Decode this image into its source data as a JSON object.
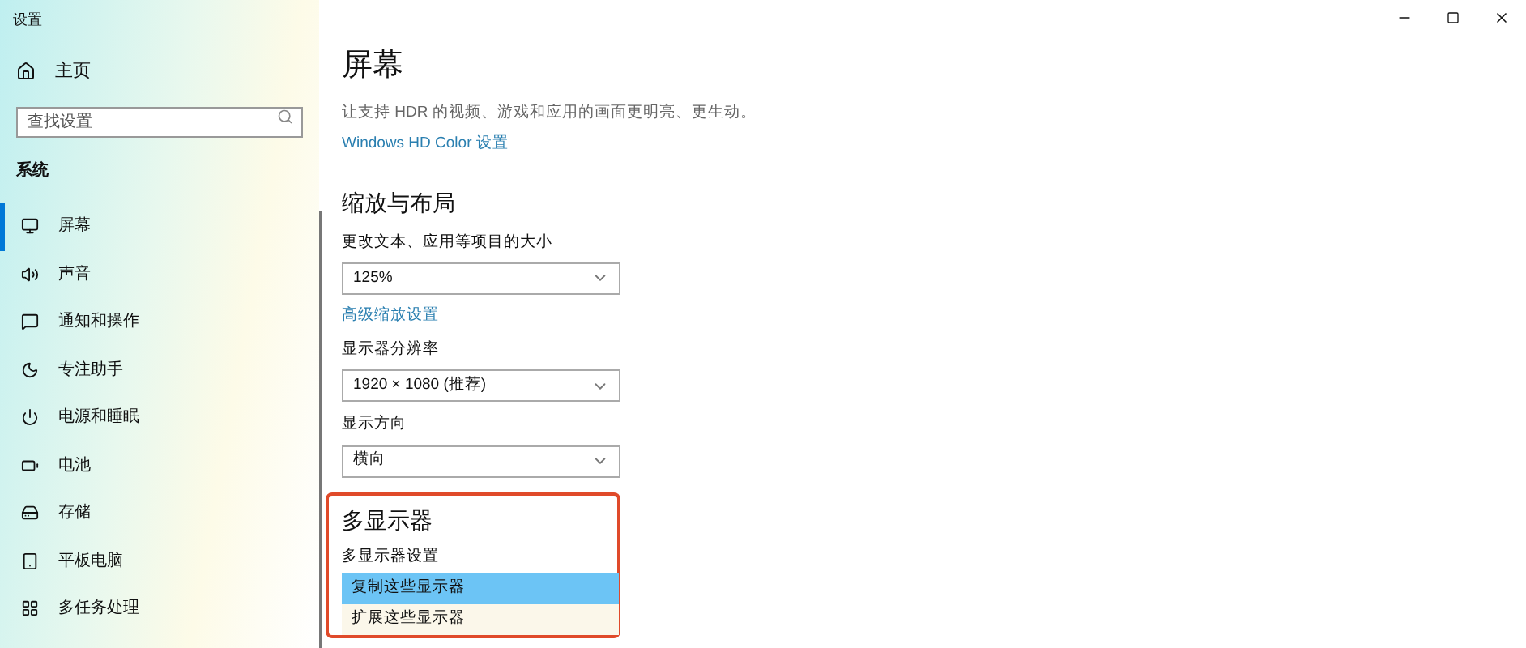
{
  "window": {
    "title": "设置"
  },
  "sidebar": {
    "home": "主页",
    "search": {
      "placeholder": "查找设置"
    },
    "section": "系统",
    "items": [
      {
        "label": "屏幕",
        "selected": true
      },
      {
        "label": "声音",
        "selected": false
      },
      {
        "label": "通知和操作",
        "selected": false
      },
      {
        "label": "专注助手",
        "selected": false
      },
      {
        "label": "电源和睡眠",
        "selected": false
      },
      {
        "label": "电池",
        "selected": false
      },
      {
        "label": "存储",
        "selected": false
      },
      {
        "label": "平板电脑",
        "selected": false
      },
      {
        "label": "多任务处理",
        "selected": false
      }
    ]
  },
  "page": {
    "title": "屏幕",
    "hdr_description": "让支持 HDR 的视频、游戏和应用的画面更明亮、更生动。",
    "hdr_link": "Windows HD Color 设置",
    "scale_heading": "缩放与布局",
    "fields": [
      {
        "kind": "dropdown",
        "label": "更改文本、应用等项目的大小",
        "value": "125%"
      },
      {
        "kind": "link",
        "label": "高级缩放设置"
      },
      {
        "kind": "dropdown",
        "label": "显示器分辨率",
        "value": "1920 × 1080 (推荐)"
      },
      {
        "kind": "dropdown",
        "label": "显示方向",
        "value": "横向"
      }
    ],
    "multi": {
      "heading": "多显示器",
      "label": "多显示器设置",
      "options": [
        {
          "label": "复制这些显示器",
          "selected": true
        },
        {
          "label": "扩展这些显示器",
          "selected": false
        }
      ]
    }
  }
}
